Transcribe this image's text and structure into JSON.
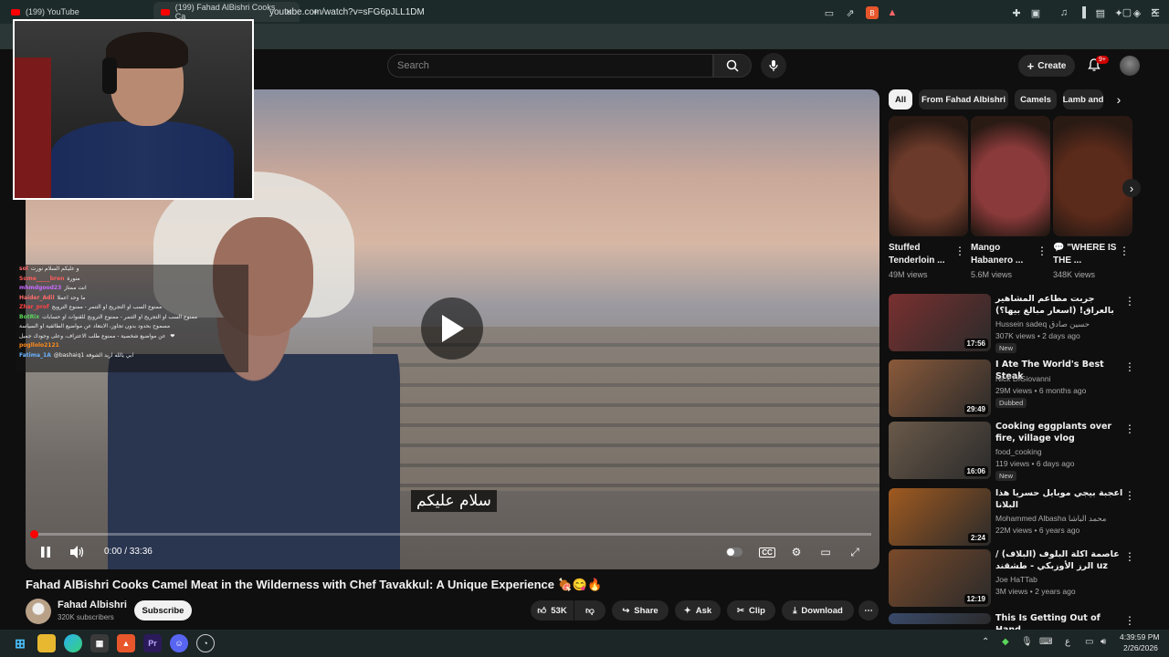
{
  "browser": {
    "tabs": [
      {
        "title": "(199) YouTube",
        "active": false
      },
      {
        "title": "(199) Fahad AlBishri Cooks Ca",
        "active": true
      }
    ],
    "new_tab": "+",
    "url": "youtube.com/watch?v=sFG6pJLL1DM",
    "win_min": "─",
    "win_max": "▢",
    "win_close": "✕"
  },
  "header": {
    "search_placeholder": "Search",
    "create_label": "Create",
    "notification_count": "9+"
  },
  "player": {
    "subtitle": "سلام عليكم",
    "time": "0:00 / 33:36",
    "progress_fraction": 0.0
  },
  "chat": [
    {
      "user": "sol",
      "color": "#ff6b6b",
      "text": "و عليكم السلام نورت"
    },
    {
      "user": "Some_____bren",
      "color": "#ff5c5c",
      "text": "منورة"
    },
    {
      "user": "mhmdgood23",
      "color": "#c86bff",
      "text": "انت ممتاز"
    },
    {
      "user": "Haider_Adil",
      "color": "#ff6b6b",
      "text": "ما وحد اعملا"
    },
    {
      "user": "Zhar_prof",
      "color": "#ff4444",
      "text": "ممنوع السب او التجريح او التنمر - ممنوع الترويج"
    },
    {
      "user": "BotRix",
      "color": "#5cd65c",
      "text": "ممنوع السب او التجريح او التنمر - ممنوع الترويج للقنوات او حسابات"
    },
    {
      "user": "",
      "color": "#ffffff",
      "text": "مسموح بحدود بدون تجاوز، الابتعاد عن مواضيع الطائفية او السياسة"
    },
    {
      "user": "",
      "color": "#ffffff",
      "text": "عن مواضيع شخصية - ممنوع طلب الاعتراف، وعلى وجودك جميل ❤"
    },
    {
      "user": "pogllolo2121",
      "color": "#ff8c1a",
      "text": ""
    },
    {
      "user": "Fatima_1A",
      "color": "#6bb3ff",
      "text": "@bashaiq1 ابي يالله اريد الشوفة"
    }
  ],
  "video": {
    "title": "Fahad AlBishri Cooks Camel Meat in the Wilderness with Chef Tavakkul: A Unique Experience 🍖😋🔥",
    "channel": "Fahad Albishri",
    "subscribers": "320K subscribers",
    "subscribe_label": "Subscribe",
    "likes": "53K",
    "share_label": "Share",
    "ask_label": "Ask",
    "clip_label": "Clip",
    "download_label": "Download"
  },
  "chips": [
    "All",
    "From Fahad Albishri",
    "Camels",
    "Lamb and"
  ],
  "shorts": [
    {
      "title": "Stuffed Tenderloin ...",
      "views": "49M views",
      "color": "#6b3a2a"
    },
    {
      "title": "Mango Habanero ...",
      "views": "5.6M views",
      "color": "#8a3a3a"
    },
    {
      "title": "💬 \"WHERE IS THE ...",
      "views": "348K views",
      "color": "#5a2a1a"
    }
  ],
  "recommended": [
    {
      "title": "جربت مطاعم المشاهير بالعراق! (اسعار مبالغ بيها؟)",
      "channel": "Hussein sadeq حسين صادق",
      "meta": "307K views • 2 days ago",
      "badge": "New",
      "duration": "17:56",
      "color": "#7a3030"
    },
    {
      "title": "I Ate The World's Best Steak",
      "channel": "Nick DiGiovanni",
      "meta": "29M views • 6 months ago",
      "badge": "Dubbed",
      "duration": "29:49",
      "color": "#8a5a3a"
    },
    {
      "title": "Cooking eggplants over fire, village vlog",
      "channel": "food_cooking",
      "meta": "119 views • 6 days ago",
      "badge": "New",
      "duration": "16:06",
      "color": "#6a5a4a"
    },
    {
      "title": "اعجبة بيجي موبايل حسريا هذا البلانا",
      "channel": "Mohammed Albasha محمد الباشا",
      "meta": "22M views • 6 years ago",
      "badge": "",
      "duration": "2:24",
      "color": "#a05a20"
    },
    {
      "title": "عاصمة اكلة البلوف (البلاف) / الرز الأوزبكي - طشقند uz",
      "channel": "Joe HaTTab",
      "meta": "3M views • 2 years ago",
      "badge": "",
      "duration": "12:19",
      "color": "#7a4a2a"
    },
    {
      "title": "This Is Getting Out of Hand...",
      "channel": "",
      "meta": "",
      "badge": "",
      "duration": "",
      "color": "#3a4a6a"
    }
  ],
  "taskbar": {
    "time": "4:39:59 PM",
    "date": "2/26/2026",
    "lang": "ع"
  }
}
